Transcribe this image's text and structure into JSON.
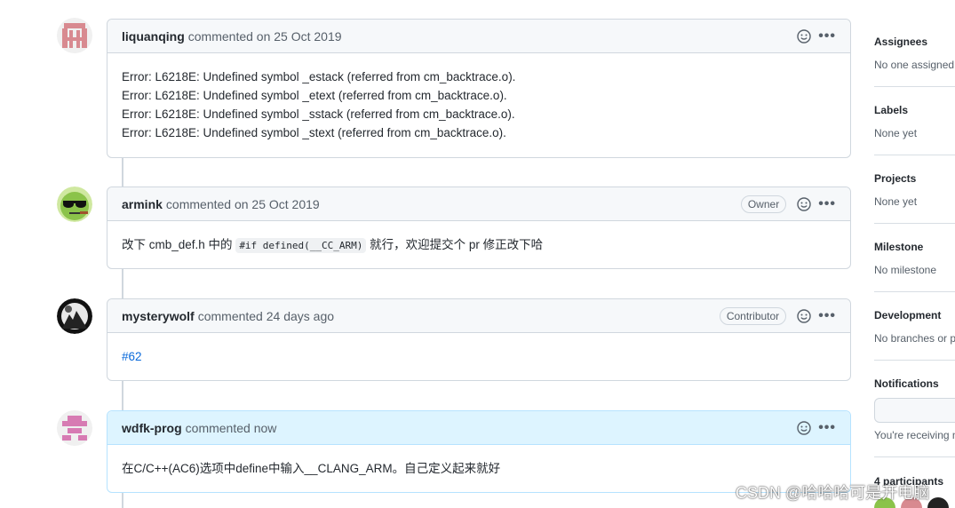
{
  "comments": [
    {
      "author": "liquanqing",
      "meta": "commented on 25 Oct 2019",
      "badge": "",
      "lines": [
        "Error: L6218E: Undefined symbol _estack (referred from cm_backtrace.o).",
        "Error: L6218E: Undefined symbol _etext (referred from cm_backtrace.o).",
        "Error: L6218E: Undefined symbol _sstack (referred from cm_backtrace.o).",
        "Error: L6218E: Undefined symbol _stext (referred from cm_backtrace.o)."
      ]
    },
    {
      "author": "armink",
      "meta": "commented on 25 Oct 2019",
      "badge": "Owner",
      "text_before": "改下 cmb_def.h 中的",
      "code": "#if defined(__CC_ARM)",
      "text_after": "就行，欢迎提交个 pr 修正改下哈"
    },
    {
      "author": "mysterywolf",
      "meta": "commented 24 days ago",
      "badge": "Contributor",
      "link": "#62"
    },
    {
      "author": "wdfk-prog",
      "meta": "commented now",
      "badge": "",
      "text": "在C/C++(AC6)选项中define中输入__CLANG_ARM。自己定义起来就好"
    }
  ],
  "sidebar": {
    "assignees": {
      "title": "Assignees",
      "value": "No one assigned"
    },
    "labels": {
      "title": "Labels",
      "value": "None yet"
    },
    "projects": {
      "title": "Projects",
      "value": "None yet"
    },
    "milestone": {
      "title": "Milestone",
      "value": "No milestone"
    },
    "development": {
      "title": "Development",
      "value": "No branches or p"
    },
    "notifications": {
      "title": "Notifications",
      "value": "You're receiving n"
    },
    "participants": {
      "title": "4 participants"
    }
  },
  "watermark": "CSDN @哈哈哈可是开电脑",
  "icons": {
    "reaction": "smiley-icon",
    "menu": "kebab-icon"
  }
}
